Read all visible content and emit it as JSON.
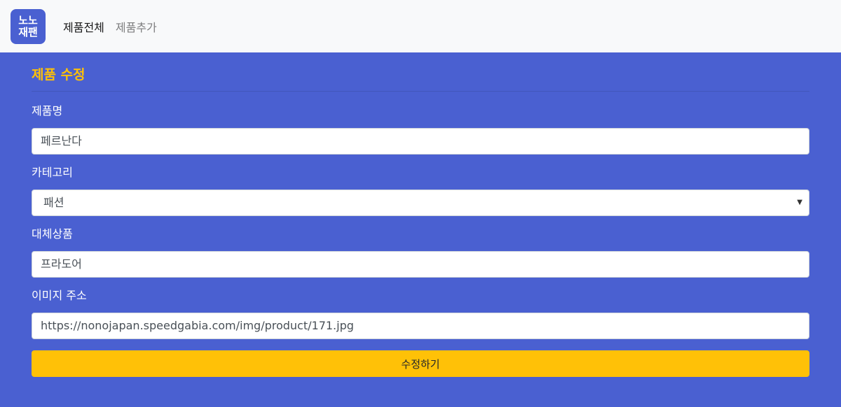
{
  "logo": {
    "line1": "노노",
    "line2": "재팬"
  },
  "nav": {
    "items": [
      {
        "label": "제품전체"
      },
      {
        "label": "제품추가"
      }
    ]
  },
  "page": {
    "title": "제품 수정"
  },
  "form": {
    "name": {
      "label": "제품명",
      "value": "페르난다"
    },
    "category": {
      "label": "카테고리",
      "value": "패션"
    },
    "alternative": {
      "label": "대체상품",
      "value": "프라도어"
    },
    "image": {
      "label": "이미지 주소",
      "value": "https://nonojapan.speedgabia.com/img/product/171.jpg"
    },
    "submit_label": "수정하기"
  },
  "colors": {
    "background": "#4a60d1",
    "accent": "#ffc107",
    "navbar": "#f8f9fa"
  }
}
